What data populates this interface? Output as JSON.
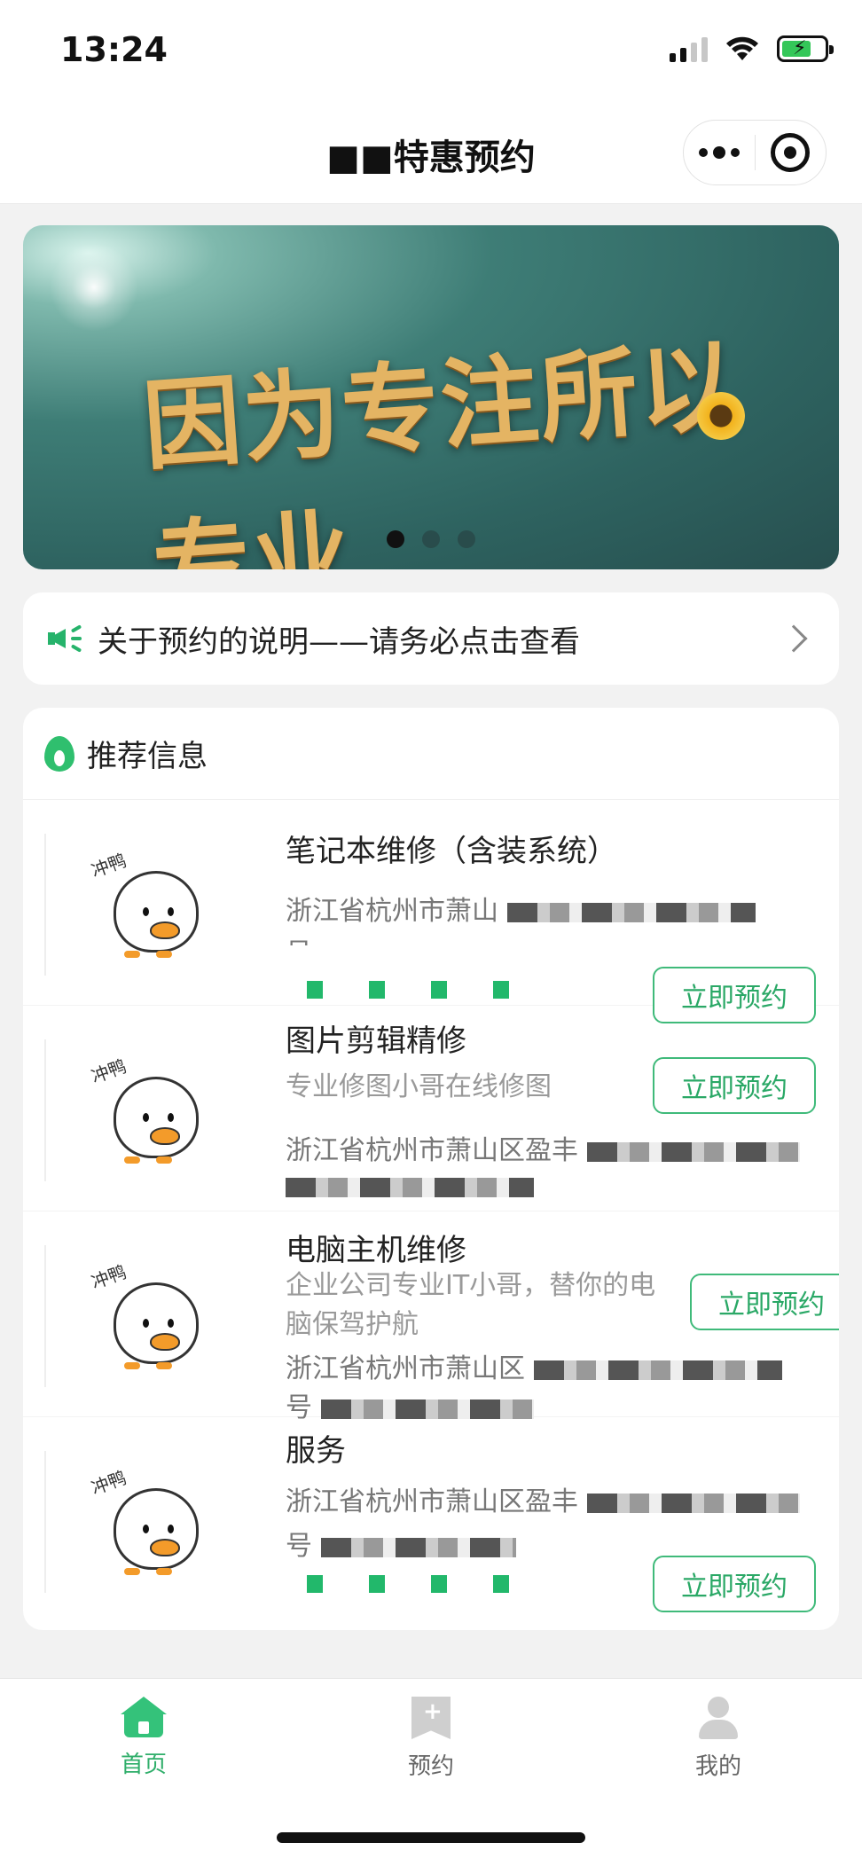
{
  "status_bar": {
    "time": "13:24"
  },
  "header": {
    "title": "■■特惠预约"
  },
  "banner": {
    "text": "因为专注所以专业",
    "slide_count": 3,
    "active_index": 0
  },
  "notice": {
    "text": "关于预约的说明——请务必点击查看"
  },
  "recommend": {
    "title": "推荐信息",
    "duck_caption": "冲鸭",
    "items": [
      {
        "title": "笔记本维修（含装系统）",
        "desc": "",
        "address": "浙江省杭州市萧山",
        "address2": "号",
        "button": "立即预约"
      },
      {
        "title": "图片剪辑精修",
        "desc": "专业修图小哥在线修图",
        "address": "浙江省杭州市萧山区盈丰",
        "address2": "",
        "button": "立即预约"
      },
      {
        "title": "电脑主机维修",
        "desc": "企业公司专业IT小哥，替你的电脑保驾护航",
        "address": "浙江省杭州市萧山区",
        "address2": "号",
        "button": "立即预约"
      },
      {
        "title": "服务",
        "desc": "",
        "address": "浙江省杭州市萧山区盈丰",
        "address2": "号",
        "button": "立即预约"
      }
    ]
  },
  "tabbar": {
    "tabs": [
      {
        "label": "首页",
        "icon": "home-icon",
        "active": true
      },
      {
        "label": "预约",
        "icon": "bookmark-plus-icon",
        "active": false
      },
      {
        "label": "我的",
        "icon": "user-icon",
        "active": false
      }
    ]
  },
  "colors": {
    "accent": "#2fae6a",
    "background": "#f2f2f2"
  }
}
